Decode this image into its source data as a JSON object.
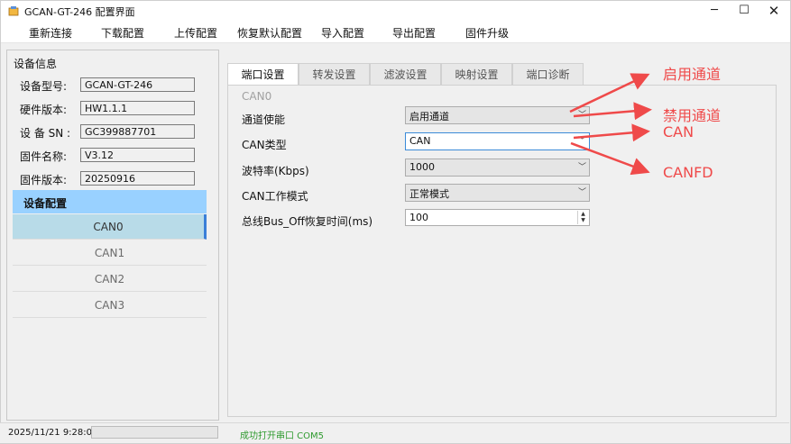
{
  "window": {
    "title": "GCAN-GT-246 配置界面"
  },
  "menu": [
    "重新连接",
    "下载配置",
    "上传配置",
    "恢复默认配置",
    "导入配置",
    "导出配置",
    "固件升级"
  ],
  "device_info": {
    "group_title": "设备信息",
    "rows": [
      {
        "label": "设备型号:",
        "value": "GCAN-GT-246"
      },
      {
        "label": "硬件版本:",
        "value": "HW1.1.1"
      },
      {
        "label": "设 备 SN :",
        "value": "GC399887701"
      },
      {
        "label": "固件名称:",
        "value": "V3.12"
      },
      {
        "label": "固件版本:",
        "value": "20250916"
      }
    ]
  },
  "device_config": {
    "title": "设备配置",
    "channels": [
      "CAN0",
      "CAN1",
      "CAN2",
      "CAN3"
    ],
    "selected": "CAN0"
  },
  "tabs": [
    "端口设置",
    "转发设置",
    "滤波设置",
    "映射设置",
    "端口诊断"
  ],
  "active_tab": "端口设置",
  "port_settings": {
    "section": "CAN0",
    "fields": [
      {
        "label": "通道使能",
        "value": "启用通道"
      },
      {
        "label": "CAN类型",
        "value": "CAN"
      },
      {
        "label": "波特率(Kbps)",
        "value": "1000"
      },
      {
        "label": "CAN工作模式",
        "value": "正常模式"
      },
      {
        "label": "总线Bus_Off恢复时间(ms)",
        "value": "100"
      }
    ]
  },
  "annotations": [
    "启用通道",
    "禁用通道",
    "CAN",
    "CANFD"
  ],
  "annotation_color": "#ef4a4a",
  "status": {
    "time": "2025/11/21 9:28:03",
    "message": "成功打开串口 COM5"
  }
}
